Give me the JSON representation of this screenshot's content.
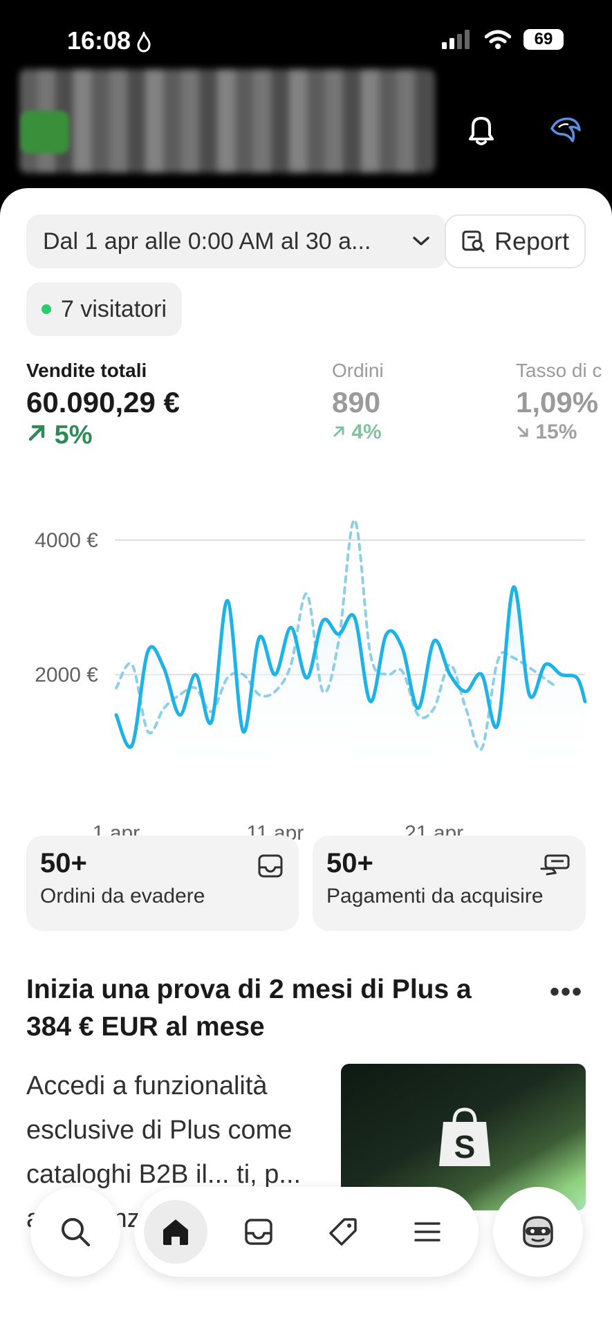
{
  "status_bar": {
    "time": "16:08",
    "battery": "69"
  },
  "filters": {
    "date_range": "Dal 1 apr alle 0:00 AM al 30 a...",
    "report_label": "Report",
    "visitors": "7 visitatori"
  },
  "metrics": [
    {
      "label": "Vendite totali",
      "value": "60.090,29 €",
      "delta": "5%",
      "direction": "up"
    },
    {
      "label": "Ordini",
      "value": "890",
      "delta": "4%",
      "direction": "up"
    },
    {
      "label": "Tasso di c",
      "value": "1,09%",
      "delta": "15%",
      "direction": "down"
    }
  ],
  "chart_data": {
    "type": "line",
    "x_tick_labels": [
      "1 apr",
      "11 apr",
      "21 apr"
    ],
    "y_tick_labels": [
      "4000 €",
      "2000 €"
    ],
    "y_ticks": [
      4000,
      2000
    ],
    "ylim": [
      800,
      4400
    ],
    "grid": true,
    "x": [
      1,
      1.5,
      2,
      2.5,
      3,
      3.5,
      4,
      4.5,
      5,
      5.5,
      6,
      6.5,
      7,
      7.5,
      8,
      8.5,
      9,
      9.5,
      10,
      10.5,
      11,
      11.5,
      12,
      12.5,
      13,
      13.5,
      14,
      14.5,
      15,
      15.5,
      16,
      16.5,
      17,
      17.5,
      18,
      18.5,
      19,
      19.5,
      20,
      20.5,
      21,
      21.5,
      22,
      22.5,
      23,
      23.5,
      24,
      24.5,
      25,
      25.5,
      26,
      26.5,
      27,
      27.5,
      28,
      28.5,
      29,
      29.5,
      30
    ],
    "series": [
      {
        "values": [
          1400,
          950,
          2350,
          2100,
          1400,
          2000,
          1300,
          3100,
          1150,
          2550,
          2000,
          2700,
          1950,
          2800,
          2600,
          2850,
          1600,
          2600,
          2400,
          1500,
          2500,
          2000,
          1750,
          2000,
          1250,
          3300,
          1700,
          2150,
          2000,
          1950,
          1600
        ],
        "x": [
          1,
          2,
          3,
          4,
          5,
          6,
          7,
          8,
          9,
          10,
          11,
          12,
          13,
          14,
          15,
          16,
          17,
          18,
          19,
          20,
          21,
          22,
          23,
          24,
          25,
          26,
          27,
          28,
          29,
          30,
          30.5
        ],
        "style": "solid"
      },
      {
        "values": [
          1800,
          2150,
          1150,
          1500,
          1700,
          1800,
          1450,
          1950,
          2000,
          1700,
          1750,
          2150,
          3200,
          1750,
          2500,
          4300,
          2300,
          2000,
          2050,
          1400,
          1500,
          2150,
          1500,
          900,
          2200,
          2250,
          1850
        ],
        "x": [
          1,
          2,
          3,
          4,
          5,
          6,
          7,
          8,
          9,
          10,
          11,
          12,
          13,
          14,
          15,
          16,
          17,
          18,
          19,
          20,
          21,
          22,
          23,
          24,
          25,
          26,
          28.5
        ],
        "style": "dashed"
      }
    ]
  },
  "cards": [
    {
      "count": "50+",
      "label": "Ordini da evadere",
      "icon": "inbox-icon"
    },
    {
      "count": "50+",
      "label": "Pagamenti da acquisire",
      "icon": "payment-icon"
    }
  ],
  "promo": {
    "title": "Inizia una prova di 2 mesi di Plus a 384 € EUR al mese",
    "more": "•••",
    "body": "Accedi a funzionalità esclusive di Plus come cataloghi B2B il... ti, p... a... avanzate del check-"
  },
  "tabbar": {
    "items": [
      "search-icon",
      "home-icon",
      "inbox-icon",
      "tag-icon",
      "menu-icon",
      "assistant-icon"
    ],
    "active": "home-icon"
  },
  "colors": {
    "accent_green": "#2e8a57",
    "chart_blue": "#1eb3e6",
    "chart_dashed": "#8fcfe6"
  }
}
